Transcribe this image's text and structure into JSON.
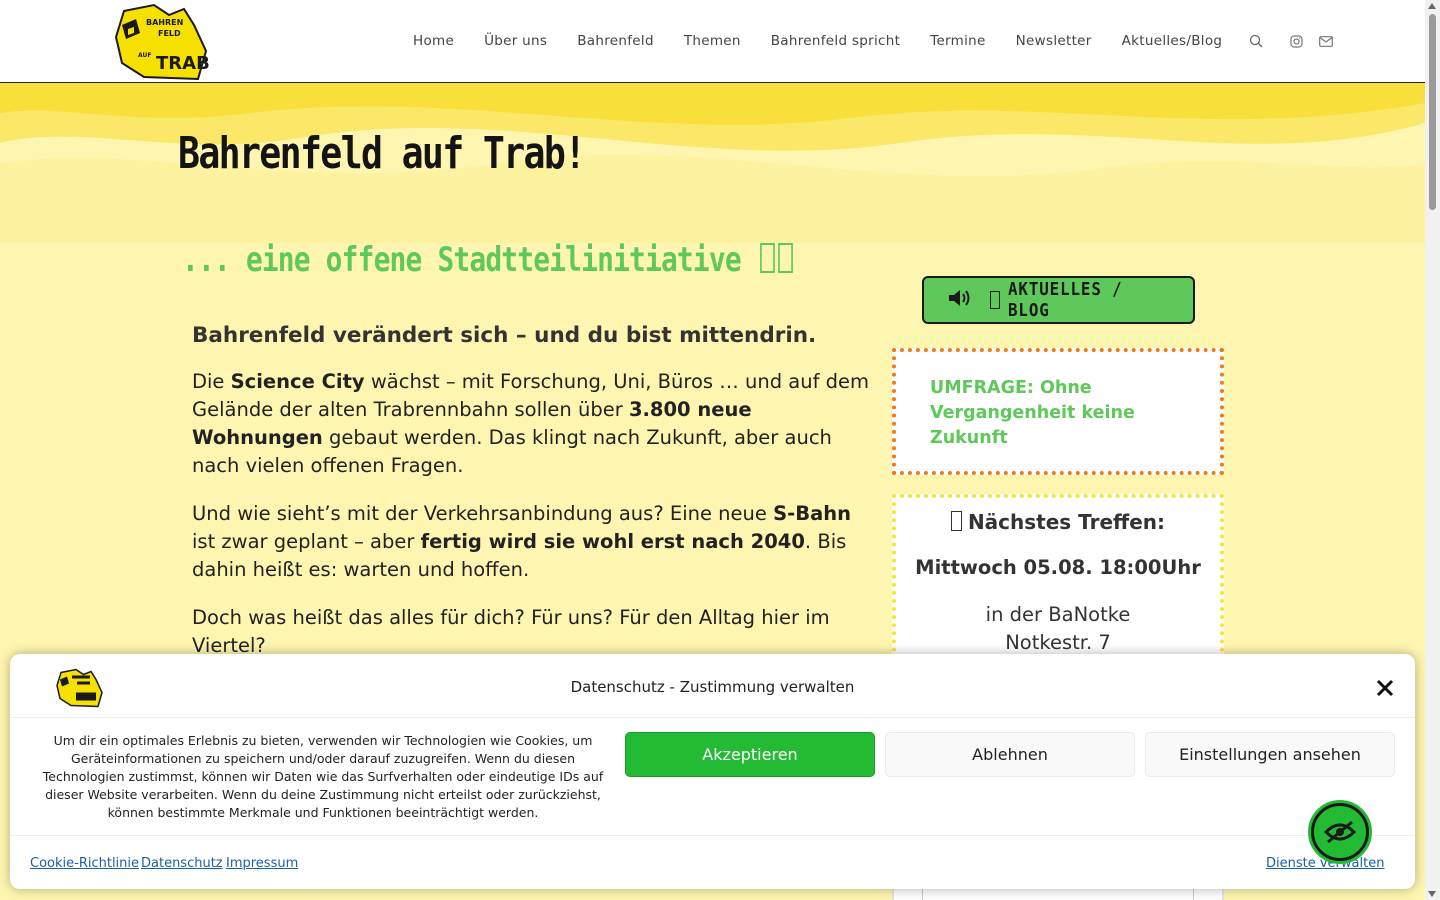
{
  "nav": {
    "items": [
      "Home",
      "Über uns",
      "Bahrenfeld",
      "Themen",
      "Bahrenfeld spricht",
      "Termine",
      "Newsletter",
      "Aktuelles/Blog"
    ]
  },
  "logo": {
    "line1": "BAHREN",
    "line2": "FELD",
    "line3": "AUF",
    "line4": "TRAB!"
  },
  "hero": {
    "title": "Bahrenfeld auf Trab!",
    "subtitle": "... eine offene Stadtteilinitiative"
  },
  "content": {
    "lead": "Bahrenfeld verändert sich – und du bist mittendrin.",
    "p1": {
      "a": "Die ",
      "b": "Science City",
      "c": " wächst – mit Forschung, Uni, Büros … und auf dem Gelände der alten Trabrennbahn sollen über ",
      "d": "3.800 neue Wohnungen",
      "e": " gebaut werden. Das klingt nach Zukunft, aber auch nach vielen offenen Fragen."
    },
    "p2": {
      "a": "Und wie sieht’s mit der Verkehrsanbindung aus? Eine neue ",
      "b": "S-Bahn",
      "c": " ist zwar geplant – aber ",
      "d": "fertig wird sie wohl erst nach 2040",
      "e": ". Bis dahin heißt es: warten und hoffen."
    },
    "p3": "Doch was heißt das alles für dich? Für uns? Für den Alltag hier im Viertel?"
  },
  "sidebar": {
    "blog_button": "AKTUELLES / BLOG",
    "survey": "UMFRAGE: Ohne Vergangenheit keine Zukunft",
    "meeting_title": "Nächstes Treffen:",
    "meeting_date": "Mittwoch 05.08. 18:00Uhr",
    "meeting_place_1": "in der BaNotke",
    "meeting_place_2": "Notkestr. 7"
  },
  "cookie": {
    "title": "Datenschutz - Zustimmung verwalten",
    "text": "Um dir ein optimales Erlebnis zu bieten, verwenden wir Technologien wie Cookies, um Geräteinformationen zu speichern und/oder darauf zuzugreifen. Wenn du diesen Technologien zustimmst, können wir Daten wie das Surfverhalten oder eindeutige IDs auf dieser Website verarbeiten. Wenn du deine Zustimmung nicht erteilst oder zurückziehst, können bestimmte Merkmale und Funktionen beeinträchtigt werden.",
    "accept": "Akzeptieren",
    "deny": "Ablehnen",
    "settings": "Einstellungen ansehen",
    "links": [
      "Cookie-Richtlinie",
      "Datenschutz",
      "Impressum"
    ],
    "manage": "Dienste verwalten"
  },
  "colors": {
    "accent_green": "#5fc85a",
    "accept_green": "#22bb33",
    "survey_border": "#f07a1a",
    "meet_border": "#f5e535",
    "bg_yellow": "#fef6b0"
  },
  "icons": [
    "search-icon",
    "instagram-icon",
    "mail-icon",
    "speaker-icon",
    "close-icon",
    "eye-off-icon"
  ]
}
